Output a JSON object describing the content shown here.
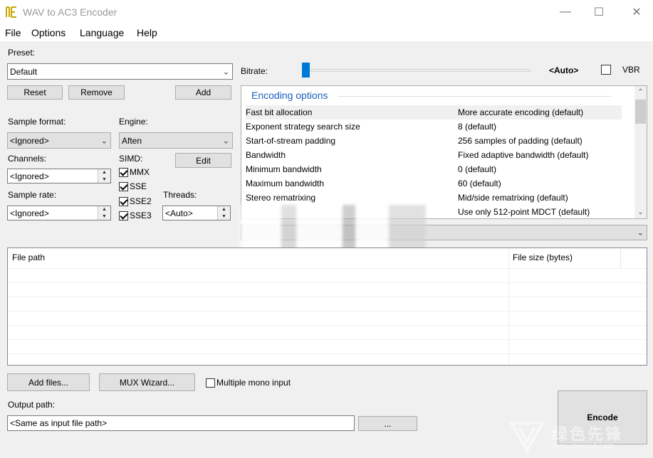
{
  "window": {
    "title": "WAV to AC3 Encoder"
  },
  "menu": [
    "File",
    "Options",
    "Language",
    "Help"
  ],
  "preset": {
    "label": "Preset:",
    "value": "Default",
    "reset": "Reset",
    "remove": "Remove",
    "add": "Add"
  },
  "bitrate": {
    "label": "Bitrate:",
    "value": "<Auto>",
    "vbr": "VBR",
    "slider_fraction": 0.0
  },
  "sample_format": {
    "label": "Sample format:",
    "value": "<Ignored>"
  },
  "engine": {
    "label": "Engine:",
    "value": "Aften"
  },
  "channels": {
    "label": "Channels:",
    "value": "<Ignored>"
  },
  "simd": {
    "label": "SIMD:",
    "edit": "Edit",
    "options": [
      {
        "label": "MMX",
        "checked": true
      },
      {
        "label": "SSE",
        "checked": true
      },
      {
        "label": "SSE2",
        "checked": true
      },
      {
        "label": "SSE3",
        "checked": true
      }
    ]
  },
  "sample_rate": {
    "label": "Sample rate:",
    "value": "<Ignored>"
  },
  "threads": {
    "label": "Threads:",
    "value": "<Auto>"
  },
  "encoding": {
    "title": "Encoding options",
    "rows": [
      {
        "name": "Fast bit allocation",
        "value": "More accurate encoding (default)"
      },
      {
        "name": "Exponent strategy search size",
        "value": "8 (default)"
      },
      {
        "name": "Start-of-stream padding",
        "value": "256 samples of padding (default)"
      },
      {
        "name": "Bandwidth",
        "value": "Fixed adaptive bandwidth (default)"
      },
      {
        "name": "Minimum bandwidth",
        "value": "0 (default)"
      },
      {
        "name": "Maximum bandwidth",
        "value": "60 (default)"
      },
      {
        "name": "Stereo rematrixing",
        "value": "Mid/side rematrixing (default)"
      },
      {
        "name": "",
        "value": "Use only 512-point MDCT (default)"
      }
    ]
  },
  "filelist": {
    "col_path": "File path",
    "col_size": "File size (bytes)"
  },
  "bottom": {
    "add_files": "Add files...",
    "mux_wizard": "MUX Wizard...",
    "mono_input": "Multiple mono input",
    "output_label": "Output path:",
    "output_value": "<Same as input file path>",
    "browse": "...",
    "encode": "Encode"
  },
  "watermark": {
    "text": "绿色先锋",
    "url": "www.greenxf.com"
  }
}
